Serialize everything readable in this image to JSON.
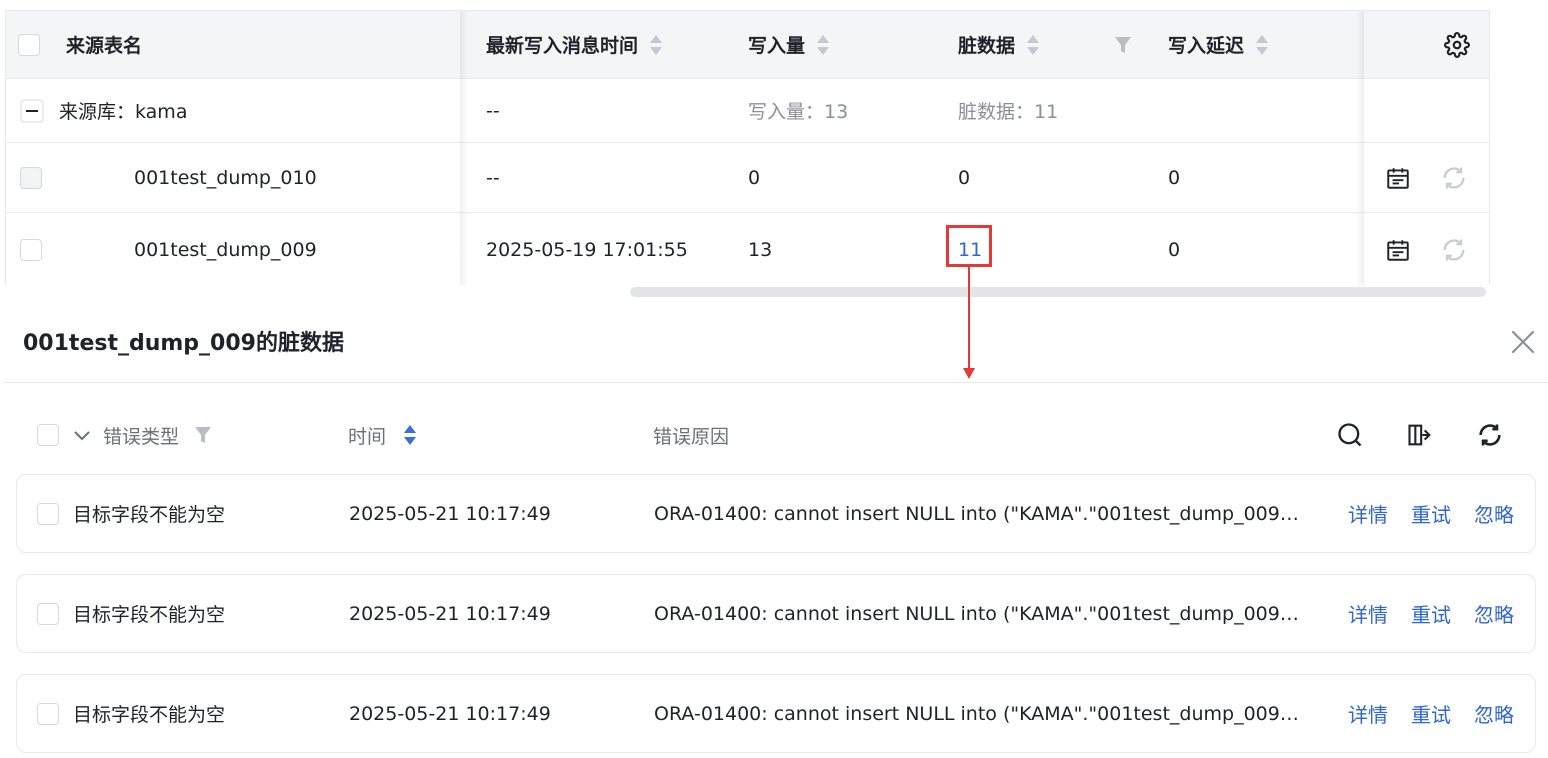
{
  "table": {
    "headers": {
      "source_table": "来源表名",
      "latest_time": "最新写入消息时间",
      "write_count": "写入量",
      "dirty_data": "脏数据",
      "write_delay": "写入延迟"
    },
    "group_row": {
      "label": "来源库：kama",
      "latest_time": "--",
      "write_count": "写入量：13",
      "dirty_data": "脏数据：11"
    },
    "rows": [
      {
        "name": "001test_dump_010",
        "latest_time": "--",
        "write_count": "0",
        "dirty_data": "0",
        "write_delay": "0"
      },
      {
        "name": "001test_dump_009",
        "latest_time": "2025-05-19 17:01:55",
        "write_count": "13",
        "dirty_data": "11",
        "write_delay": "0"
      }
    ]
  },
  "drawer": {
    "title": "001test_dump_009的脏数据",
    "columns": {
      "error_type": "错误类型",
      "time": "时间",
      "reason": "错误原因"
    },
    "errors": [
      {
        "type": "目标字段不能为空",
        "time": "2025-05-21 10:17:49",
        "reason": "ORA-01400: cannot insert NULL into (\"KAMA\".\"001test_dump_009…"
      },
      {
        "type": "目标字段不能为空",
        "time": "2025-05-21 10:17:49",
        "reason": "ORA-01400: cannot insert NULL into (\"KAMA\".\"001test_dump_009…"
      },
      {
        "type": "目标字段不能为空",
        "time": "2025-05-21 10:17:49",
        "reason": "ORA-01400: cannot insert NULL into (\"KAMA\".\"001test_dump_009…"
      }
    ],
    "actions": {
      "detail": "详情",
      "retry": "重试",
      "ignore": "忽略"
    }
  },
  "colors": {
    "link": "#2f66d0",
    "highlight": "#e53935",
    "header_bg": "#f4f5f7"
  }
}
